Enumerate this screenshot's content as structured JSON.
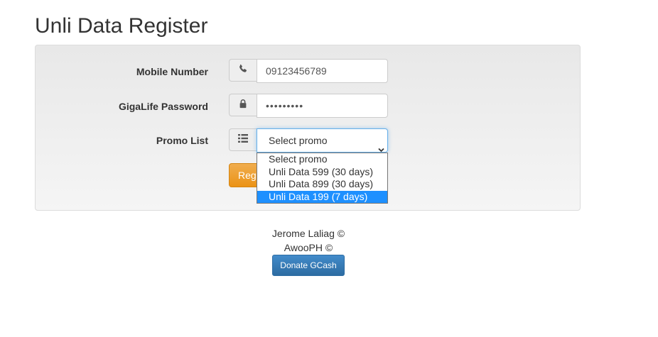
{
  "page": {
    "title": "Unli Data Register"
  },
  "form": {
    "mobile": {
      "label": "Mobile Number",
      "icon": "phone-icon",
      "value": "09123456789"
    },
    "password": {
      "label": "GigaLife Password",
      "icon": "lock-icon",
      "value": "•••••••••"
    },
    "promo": {
      "label": "Promo List",
      "icon": "list-icon",
      "selected": "Select promo",
      "options": [
        "Select promo",
        "Unli Data 599 (30 days)",
        "Unli Data 899 (30 days)",
        "Unli Data 199 (7 days)"
      ],
      "highlighted_index": 3
    },
    "register_button_label": "Register"
  },
  "footer": {
    "credit_1": "Jerome Laliag ©",
    "credit_2": "AwooPH ©",
    "donate_label": "Donate GCash"
  },
  "colors": {
    "accent_orange": "#f0ad4e",
    "primary_blue": "#337ab7",
    "highlight": "#1e90ff"
  }
}
